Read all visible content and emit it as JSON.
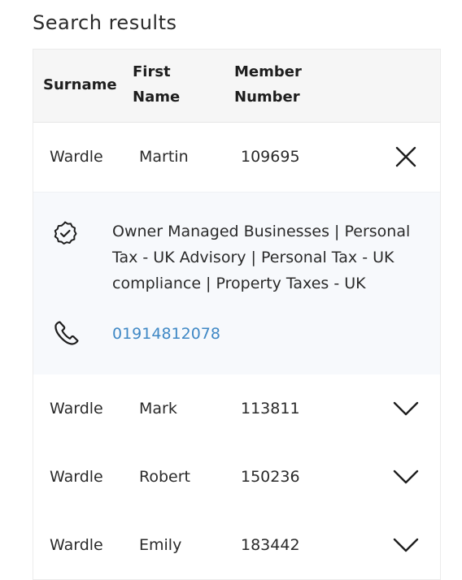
{
  "page": {
    "title": "Search results"
  },
  "table": {
    "headers": {
      "surname": "Surname",
      "first_name_line1": "First",
      "first_name_line2": "Name",
      "member_line1": "Member",
      "member_line2": "Number"
    },
    "rows": [
      {
        "surname": "Wardle",
        "first_name": "Martin",
        "member_number": "109695",
        "expanded": true,
        "toggle_icon": "close-icon",
        "details": {
          "specialisms": "Owner Managed Businesses | Personal Tax - UK Advisory | Personal Tax - UK compliance | Property Taxes - UK",
          "specialisms_icon": "check-badge-icon",
          "phone": "01914812078",
          "phone_icon": "phone-icon"
        }
      },
      {
        "surname": "Wardle",
        "first_name": "Mark",
        "member_number": "113811",
        "expanded": false,
        "toggle_icon": "chevron-down-icon"
      },
      {
        "surname": "Wardle",
        "first_name": "Robert",
        "member_number": "150236",
        "expanded": false,
        "toggle_icon": "chevron-down-icon"
      },
      {
        "surname": "Wardle",
        "first_name": "Emily",
        "member_number": "183442",
        "expanded": false,
        "toggle_icon": "chevron-down-icon"
      }
    ]
  },
  "colors": {
    "link": "#3f88c5",
    "header_bg": "#f6f6f6",
    "details_bg": "#f7f9fc",
    "text": "#2a2a2a"
  }
}
